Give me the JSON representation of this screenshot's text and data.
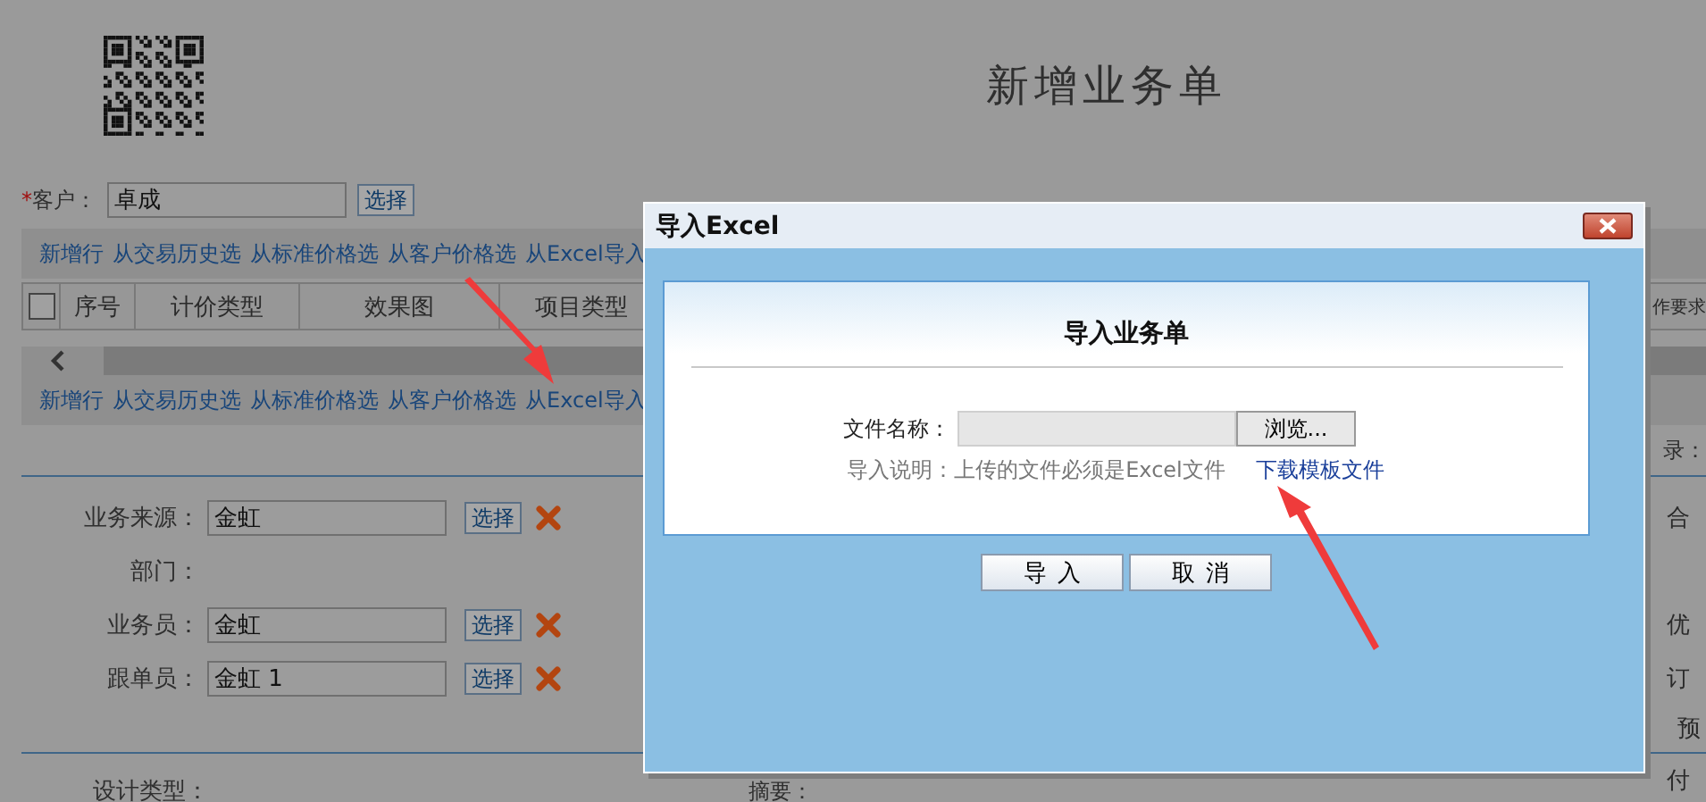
{
  "page": {
    "title": "新增业务单"
  },
  "customer": {
    "required_mark": "*",
    "label": "客户：",
    "value": "卓成",
    "select_button": "选择"
  },
  "toolbar_links": [
    "新增行",
    "从交易历史选",
    "从标准价格选",
    "从客户价格选",
    "从Excel导入"
  ],
  "table": {
    "select_all_checked": false,
    "columns": [
      "序号",
      "计价类型",
      "效果图",
      "项目类型",
      "作要求"
    ]
  },
  "bottom_links": [
    "新增行",
    "从交易历史选",
    "从标准价格选",
    "从客户价格选",
    "从Excel导入"
  ],
  "records_label": "录：",
  "staff_fields": [
    {
      "kind": "picker",
      "label": "业务来源：",
      "value": "金虹",
      "select_button": "选择"
    },
    {
      "kind": "static",
      "label": "部门："
    },
    {
      "kind": "picker",
      "label": "业务员：",
      "value": "金虹",
      "select_button": "选择"
    },
    {
      "kind": "picker",
      "label": "跟单员：",
      "value": "金虹 1",
      "select_button": "选择"
    }
  ],
  "summary_labels": [
    "合",
    "优",
    "订",
    "预",
    "付"
  ],
  "design_type": {
    "label": "设计类型："
  },
  "abstract": {
    "label": "摘要："
  },
  "dialog": {
    "title": "导入Excel",
    "heading": "导入业务单",
    "file_label": "文件名称：",
    "browse_button": "浏览...",
    "note": "导入说明：上传的文件必须是Excel文件",
    "template_link": "下载模板文件",
    "buttons": [
      "导入",
      "取消"
    ]
  }
}
